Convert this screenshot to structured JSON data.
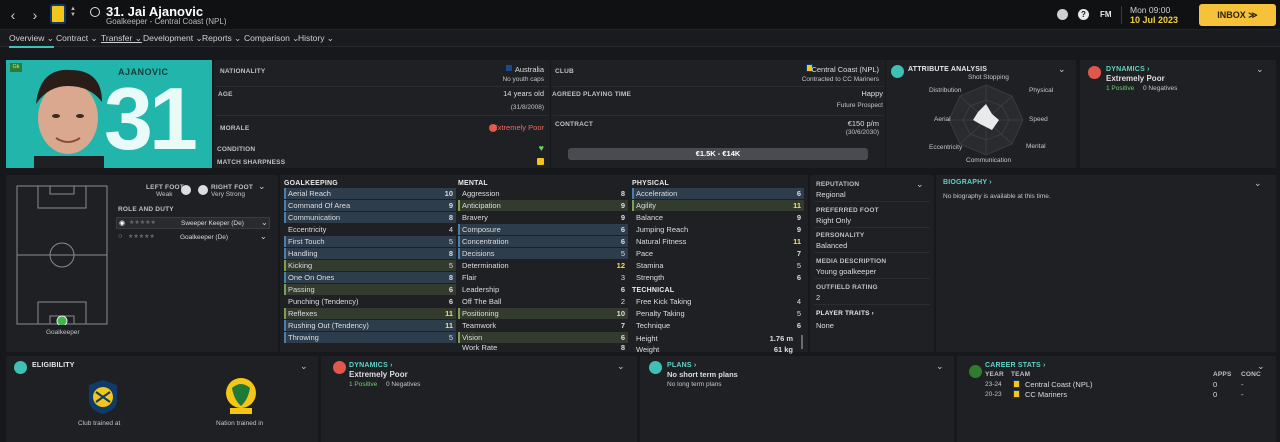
{
  "topbar": {
    "back": "‹",
    "forward": "›",
    "title": "31. Jai Ajanovic",
    "subtitle": "Goalkeeper - Central Coast (NPL)",
    "time": "Mon 09:00",
    "date": "10 Jul 2023",
    "fm_label": "FM",
    "help_label": "?",
    "inbox_label": "INBOX ≫"
  },
  "tabs": [
    {
      "label": "Overview ⌄"
    },
    {
      "label": "Contract ⌄"
    },
    {
      "label": "Transfer ⌄"
    },
    {
      "label": "Development ⌄"
    },
    {
      "label": "Reports ⌄"
    },
    {
      "label": "Comparison ⌄"
    },
    {
      "label": "History ⌄"
    }
  ],
  "profile": {
    "badge": "Gk",
    "surname": "AJANOVIC",
    "number": "31",
    "nationality_label": "NATIONALITY",
    "nationality": "Australia",
    "youth_caps": "No youth caps",
    "age_label": "AGE",
    "age": "14 years old",
    "dob": "(31/8/2008)",
    "morale_label": "MORALE",
    "morale": "Extremely Poor",
    "condition_label": "CONDITION",
    "sharpness_label": "MATCH SHARPNESS",
    "club_label": "CLUB",
    "club": "Central Coast (NPL)",
    "club_sub": "Contracted to CC Mariners",
    "playing_time_label": "AGREED PLAYING TIME",
    "playing_time": "Happy",
    "playing_time_sub": "Future Prospect",
    "contract_label": "CONTRACT",
    "wage": "€150 p/m",
    "contract_end": "(30/6/2030)",
    "value": "€1.5K - €14K"
  },
  "attribute_analysis": {
    "title": "ATTRIBUTE ANALYSIS",
    "axes": [
      "Shot Stopping",
      "Physical",
      "Speed",
      "Mental",
      "Communication",
      "Eccentricity",
      "Aerial",
      "Distribution"
    ]
  },
  "dynamics_top": {
    "title": "DYNAMICS ›",
    "status": "Extremely Poor",
    "positives": "1 Positive",
    "negatives": "0 Negatives"
  },
  "pitch": {
    "position_label": "Goalkeeper",
    "left_foot_label": "LEFT FOOT",
    "left_foot": "Weak",
    "right_foot_label": "RIGHT FOOT",
    "right_foot": "Very Strong",
    "role_title": "ROLE AND DUTY",
    "roles": [
      {
        "name": "Sweeper Keeper (De)",
        "stars": "★★★★★"
      },
      {
        "name": "Goalkeeper (De)",
        "stars": "★★★★★"
      }
    ]
  },
  "goalkeeping": {
    "title": "GOALKEEPING",
    "rows": [
      {
        "name": "Aerial Reach",
        "value": "10"
      },
      {
        "name": "Command Of Area",
        "value": "9"
      },
      {
        "name": "Communication",
        "value": "8"
      },
      {
        "name": "Eccentricity",
        "value": "4"
      },
      {
        "name": "First Touch",
        "value": "5"
      },
      {
        "name": "Handling",
        "value": "8"
      },
      {
        "name": "Kicking",
        "value": "5"
      },
      {
        "name": "One On Ones",
        "value": "8"
      },
      {
        "name": "Passing",
        "value": "6"
      },
      {
        "name": "Punching (Tendency)",
        "value": "6"
      },
      {
        "name": "Reflexes",
        "value": "11"
      },
      {
        "name": "Rushing Out (Tendency)",
        "value": "11"
      },
      {
        "name": "Throwing",
        "value": "5"
      }
    ]
  },
  "mental": {
    "title": "MENTAL",
    "rows": [
      {
        "name": "Aggression",
        "value": "8"
      },
      {
        "name": "Anticipation",
        "value": "9"
      },
      {
        "name": "Bravery",
        "value": "9"
      },
      {
        "name": "Composure",
        "value": "6"
      },
      {
        "name": "Concentration",
        "value": "6"
      },
      {
        "name": "Decisions",
        "value": "5"
      },
      {
        "name": "Determination",
        "value": "12"
      },
      {
        "name": "Flair",
        "value": "3"
      },
      {
        "name": "Leadership",
        "value": "6"
      },
      {
        "name": "Off The Ball",
        "value": "2"
      },
      {
        "name": "Positioning",
        "value": "10"
      },
      {
        "name": "Teamwork",
        "value": "7"
      },
      {
        "name": "Vision",
        "value": "6"
      },
      {
        "name": "Work Rate",
        "value": "8"
      }
    ]
  },
  "physical": {
    "title": "PHYSICAL",
    "rows": [
      {
        "name": "Acceleration",
        "value": "6"
      },
      {
        "name": "Agility",
        "value": "11"
      },
      {
        "name": "Balance",
        "value": "9"
      },
      {
        "name": "Jumping Reach",
        "value": "9"
      },
      {
        "name": "Natural Fitness",
        "value": "11"
      },
      {
        "name": "Pace",
        "value": "7"
      },
      {
        "name": "Stamina",
        "value": "5"
      },
      {
        "name": "Strength",
        "value": "6"
      }
    ]
  },
  "technical": {
    "title": "TECHNICAL",
    "rows": [
      {
        "name": "Free Kick Taking",
        "value": "4"
      },
      {
        "name": "Penalty Taking",
        "value": "5"
      },
      {
        "name": "Technique",
        "value": "6"
      }
    ]
  },
  "measures": {
    "height_label": "Height",
    "height": "1.76 m",
    "weight_label": "Weight",
    "weight": "61 kg"
  },
  "info": {
    "reputation_label": "REPUTATION",
    "reputation": "Regional",
    "foot_label": "PREFERRED FOOT",
    "foot": "Right Only",
    "personality_label": "PERSONALITY",
    "personality": "Balanced",
    "media_label": "MEDIA DESCRIPTION",
    "media": "Young goalkeeper",
    "outfield_label": "OUTFIELD RATING",
    "outfield": "2",
    "traits_label": "PLAYER TRAITS ›",
    "traits": "None"
  },
  "biography": {
    "title": "BIOGRAPHY ›",
    "text": "No biography is available at this time."
  },
  "eligibility": {
    "title": "ELIGIBILITY",
    "club_trained": "Club trained at",
    "nation_trained": "Nation trained in"
  },
  "dynamics_bottom": {
    "title": "DYNAMICS ›",
    "status": "Extremely Poor",
    "positives": "1 Positive",
    "negatives": "0 Negatives"
  },
  "plans": {
    "title": "PLANS ›",
    "short": "No short term plans",
    "long": "No long term plans"
  },
  "career": {
    "title": "CAREER STATS ›",
    "col_year": "YEAR",
    "col_team": "TEAM",
    "col_apps": "APPS",
    "col_conc": "CONC",
    "rows": [
      {
        "year": "23-24",
        "team": "Central Coast (NPL)",
        "apps": "0",
        "conc": "-"
      },
      {
        "year": "20-23",
        "team": "CC Mariners",
        "apps": "0",
        "conc": "-"
      }
    ]
  },
  "colors": {
    "accent": "#3ec1b4",
    "inbox": "#f6c23a",
    "morale_bad": "#e2574c"
  }
}
